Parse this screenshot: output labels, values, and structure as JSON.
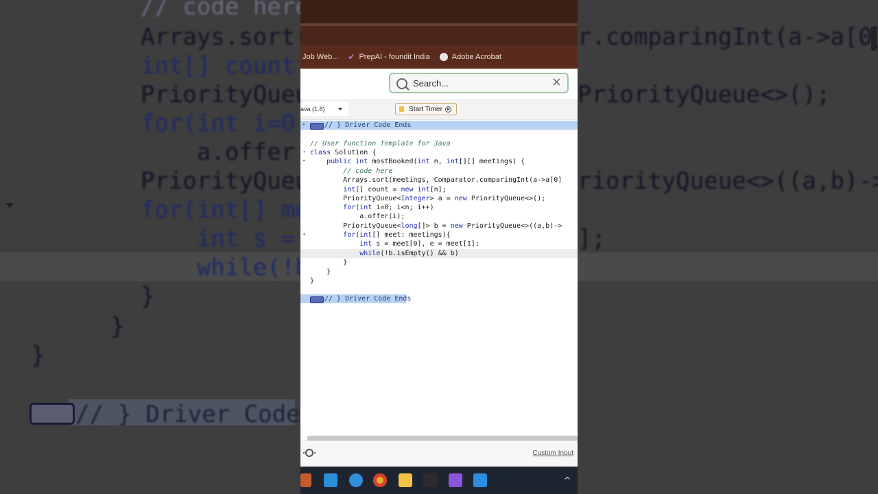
{
  "background": {
    "lines": [
      {
        "text": "// code here"
      },
      {
        "text": "Arrays.sort("
      },
      {
        "text": "int[] count"
      },
      {
        "text": "PriorityQueu"
      },
      {
        "text": "for(int i=0;"
      },
      {
        "text": "    a.offer"
      },
      {
        "text": "PriorityQueu"
      },
      {
        "text": "for(int[] mee"
      },
      {
        "text": "    int s ="
      },
      {
        "text": "    while(!b"
      },
      {
        "text": "}"
      },
      {
        "text": "  }"
      },
      {
        "text": "}"
      }
    ],
    "right_lines": [
      {
        "text": "r.comparingInt(a->a[0]"
      },
      {
        "text": "PriorityQueue<>();"
      },
      {
        "text": "riorityQueue<>((a,b)->"
      },
      {
        "text": "];"
      }
    ],
    "end_text": "// } Driver Code"
  },
  "browser": {
    "bookmarks": [
      {
        "label": "Job Web...",
        "icon": "globe-icon"
      },
      {
        "label": "PrepAI - foundit India",
        "icon": "check-icon"
      },
      {
        "label": "Adobe Acrobat",
        "icon": "acrobat-icon"
      }
    ]
  },
  "search": {
    "placeholder": "Search...",
    "close": "×"
  },
  "toolbar": {
    "language": "ava (1.8)",
    "timer_label": "Start Timer"
  },
  "editor": {
    "driver_end_top": "// } Driver Code Ends",
    "comment_template": "// User function Template for Java",
    "lines": [
      "class Solution {",
      "    public int mostBooked(int n, int[][] meetings) {",
      "        // code here",
      "        Arrays.sort(meetings, Comparator.comparingInt(a->a[0]",
      "        int[] count = new int[n];",
      "        PriorityQueue<Integer> a = new PriorityQueue<>();",
      "        for(int i=0; i<n; i++)",
      "            a.offer(i);",
      "        PriorityQueue<long[]> b = new PriorityQueue<>((a,b)->",
      "        for(int[] meet: meetings){",
      "            int s = meet[0], e = meet[1];",
      "            while(!b.isEmpty() && b)",
      "        }",
      "    }",
      "}"
    ],
    "driver_end_bottom": "// } Driver Code Ends"
  },
  "bottom": {
    "custom_input": "Custom Input"
  },
  "taskbar": {
    "icons": [
      "start-icon",
      "mail-icon",
      "edge-icon",
      "chrome-icon",
      "folder-icon",
      "terminal-icon",
      "media-icon",
      "screen-icon"
    ],
    "chevron": "^"
  },
  "colors": {
    "accent": "#1a2aa8",
    "highlight": "#b8d2f3",
    "comment": "#3c7a5a"
  }
}
